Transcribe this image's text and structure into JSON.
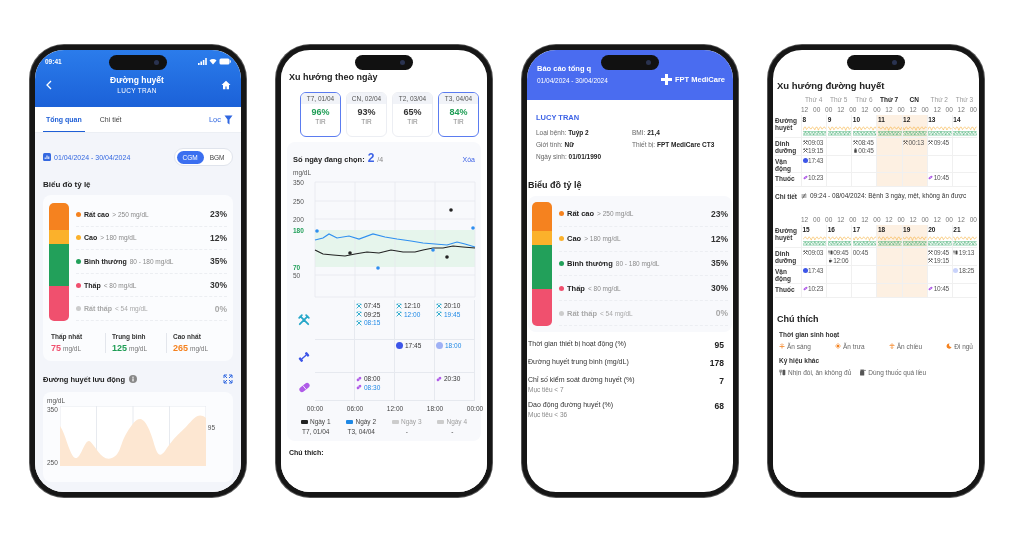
{
  "phones": [
    {
      "kind": "overview",
      "status_time": "09:41",
      "title": "Đường huyết",
      "subtitle": "LUCY TRAN",
      "tabs": [
        {
          "label": "Tổng quan",
          "selected": true
        },
        {
          "label": "Chi tiết",
          "selected": false
        }
      ],
      "filter_label": "Lọc",
      "date_range": "01/04/2024 - 30/04/2024",
      "modes": [
        {
          "label": "CGM",
          "selected": true
        },
        {
          "label": "BGM",
          "selected": false
        }
      ],
      "ratio_title": "Biểu đồ tỷ lệ",
      "ranges": [
        {
          "label": "Rất cao",
          "range": "> 250 mg/dL",
          "percent": "23%",
          "color": "#f5821f",
          "disabled": false
        },
        {
          "label": "Cao",
          "range": "> 180 mg/dL",
          "percent": "12%",
          "color": "#fbb12b",
          "disabled": false
        },
        {
          "label": "Bình thường",
          "range": "80 - 180 mg/dL",
          "percent": "35%",
          "color": "#22a05a",
          "disabled": false
        },
        {
          "label": "Thấp",
          "range": "< 80 mg/dL",
          "percent": "30%",
          "color": "#f0506e",
          "disabled": false
        },
        {
          "label": "Rất thấp",
          "range": "< 54 mg/dL",
          "percent": "0%",
          "color": "#cccccc",
          "disabled": true
        }
      ],
      "stats": [
        {
          "label": "Thấp nhất",
          "value": "75",
          "unit": "mg/dL",
          "color": "#f0506e"
        },
        {
          "label": "Trung bình",
          "value": "125",
          "unit": "mg/dL",
          "color": "#1f9d55"
        },
        {
          "label": "Cao nhất",
          "value": "265",
          "unit": "mg/dL",
          "color": "#f5821f"
        }
      ],
      "ambulatory": {
        "title": "Đường huyết lưu động",
        "unit": "mg/dL",
        "y_labels": [
          "350",
          "250"
        ],
        "right_label": "95"
      }
    },
    {
      "kind": "daily",
      "title": "Xu hướng theo ngày",
      "days": [
        {
          "label": "T7, 01/04",
          "percent": "96%",
          "caption": "TIR",
          "selected": true
        },
        {
          "label": "CN, 02/04",
          "percent": "93%",
          "caption": "TIR",
          "selected": false
        },
        {
          "label": "T2, 03/04",
          "percent": "65%",
          "caption": "TIR",
          "selected": false
        },
        {
          "label": "T3, 04/04",
          "percent": "84%",
          "caption": "TIR",
          "selected": true
        }
      ],
      "selection_label": "Số ngày đang chọn:",
      "selected_count": "2",
      "total_count": "/4",
      "clear_label": "Xóa",
      "chart": {
        "unit": "mg/dL",
        "y_labels": [
          {
            "text": "350",
            "kind": "axis"
          },
          {
            "text": "250",
            "kind": "axis"
          },
          {
            "text": "200",
            "kind": "axis"
          },
          {
            "text": "180",
            "kind": "target"
          },
          {
            "text": "70",
            "kind": "target"
          },
          {
            "text": "50",
            "kind": "axis"
          }
        ],
        "x_labels": [
          "00:00",
          "06:00",
          "12:00",
          "18:00",
          "00:00"
        ]
      },
      "event_rows": [
        {
          "kind": "meal",
          "entries": [
            {
              "time": "07:45",
              "highlighted": false
            },
            {
              "time": "09:25",
              "highlighted": false
            },
            {
              "time": "08:15",
              "highlighted": true
            },
            {
              "time": "12:10",
              "highlighted": false
            },
            {
              "time": "12:00",
              "highlighted": true
            },
            {
              "time": "20:10",
              "highlighted": false
            },
            {
              "time": "19:45",
              "highlighted": true
            }
          ]
        },
        {
          "kind": "exercise",
          "entries": [
            {
              "time": "17:45",
              "highlighted": false,
              "dot": {
                "color": "#3d55e8"
              }
            },
            {
              "time": "18:00",
              "highlighted": true,
              "dot": {
                "color": "#9fb1f5"
              }
            }
          ]
        },
        {
          "kind": "medicine",
          "entries": [
            {
              "time": "08:00",
              "highlighted": false
            },
            {
              "time": "08:30",
              "highlighted": true
            },
            {
              "time": "20:30",
              "highlighted": false
            }
          ]
        }
      ],
      "legend": [
        {
          "label": "Ngày 1",
          "color": "#222222",
          "date": "T7, 01/04",
          "disabled": false
        },
        {
          "label": "Ngày 2",
          "color": "#1e88e5",
          "date": "T3, 04/04",
          "disabled": false
        },
        {
          "label": "Ngày 3",
          "color": "#cccccc",
          "date": "-",
          "disabled": true
        },
        {
          "label": "Ngày 4",
          "color": "#cccccc",
          "date": "-",
          "disabled": true
        }
      ],
      "notes_title": "Chú thích:"
    },
    {
      "kind": "report",
      "title": "Báo cáo tổng q",
      "date_range": "01/04/2024 - 30/04/2024",
      "brand": "FPT MediCare",
      "patient": "LUCY TRAN",
      "info": [
        {
          "label": "Loại bệnh:",
          "value": "Tuýp 2"
        },
        {
          "label": "BMI:",
          "value": "21,4"
        },
        {
          "label": "Giới tính:",
          "value": "Nữ"
        },
        {
          "label": "Thiết bị:",
          "value": "FPT MediCare CT3"
        },
        {
          "label": "Ngày sinh:",
          "value": "01/01/1990"
        }
      ],
      "ratio_title": "Biểu đồ tỷ lệ",
      "ranges": [
        {
          "label": "Rất cao",
          "range": "> 250 mg/dL",
          "percent": "23%",
          "color": "#f5821f",
          "disabled": false
        },
        {
          "label": "Cao",
          "range": "> 180 mg/dL",
          "percent": "12%",
          "color": "#fbb12b",
          "disabled": false
        },
        {
          "label": "Bình thường",
          "range": "80 - 180 mg/dL",
          "percent": "35%",
          "color": "#22a05a",
          "disabled": false
        },
        {
          "label": "Thấp",
          "range": "< 80 mg/dL",
          "percent": "30%",
          "color": "#f0506e",
          "disabled": false
        },
        {
          "label": "Rất thấp",
          "range": "< 54 mg/dL",
          "percent": "0%",
          "color": "#cccccc",
          "disabled": true
        }
      ],
      "metrics": [
        {
          "label": "Thời gian thiết bị hoạt động (%)",
          "value": "95"
        },
        {
          "label": "Đường huyết trung bình (mg/dL)",
          "value": "178"
        },
        {
          "label": "Chỉ số kiểm soát đường huyết (%)",
          "value": "7",
          "target": "Mục tiêu < 7"
        },
        {
          "label": "Dao động đường huyết (%)",
          "value": "68",
          "target": "Mục tiêu < 36"
        }
      ]
    },
    {
      "kind": "weekly",
      "title": "Xu hướng đường huyết",
      "weeks": [
        {
          "rows": [
            {
              "label": "Đường huyết",
              "kind": "glucose"
            },
            {
              "label": "Dinh dưỡng",
              "kind": "nutrition"
            },
            {
              "label": "Vận động",
              "kind": "exercise"
            },
            {
              "label": "Thuốc",
              "kind": "medicine"
            }
          ],
          "hours": [
            "12",
            "00",
            "00",
            "12",
            "00",
            "12",
            "00",
            "12",
            "00",
            "12",
            "00",
            "12",
            "00",
            "12",
            "00"
          ],
          "days": [
            {
              "label": "Thứ 4",
              "weekend": false,
              "date": "8",
              "nutrition": [
                {
                  "time": "09:03",
                  "kind": "meal"
                },
                {
                  "time": "19:15",
                  "kind": "meal"
                }
              ],
              "exercise": [
                {
                  "time": "17:43",
                  "color": "#3d55e8"
                }
              ],
              "medicine": [
                {
                  "time": "10:23"
                }
              ]
            },
            {
              "label": "Thứ 5",
              "weekend": false,
              "date": "9"
            },
            {
              "label": "Thứ 6",
              "weekend": false,
              "date": "10",
              "nutrition": [
                {
                  "time": "08:45",
                  "kind": "meal"
                },
                {
                  "time": "00:45",
                  "kind": "drink"
                }
              ]
            },
            {
              "label": "Thứ 7",
              "weekend": true,
              "date": "11"
            },
            {
              "label": "CN",
              "weekend": true,
              "date": "12",
              "nutrition": [
                {
                  "time": "00:13",
                  "kind": "meal"
                }
              ]
            },
            {
              "label": "Thứ 2",
              "weekend": false,
              "date": "13",
              "nutrition": [
                {
                  "time": "09:45",
                  "kind": "meal"
                }
              ],
              "medicine": [
                {
                  "time": "10:45"
                }
              ]
            },
            {
              "label": "Thứ 3",
              "weekend": false,
              "date": "14"
            }
          ],
          "detail": {
            "label": "Chi tiết",
            "text": "09:24 - 08/04/2024: Bệnh 3 ngày, mệt, không ăn được"
          }
        },
        {
          "rows": [
            {
              "label": "Đường huyết",
              "kind": "glucose"
            },
            {
              "label": "Dinh dưỡng",
              "kind": "nutrition"
            },
            {
              "label": "Vận động",
              "kind": "exercise"
            },
            {
              "label": "Thuốc",
              "kind": "medicine"
            }
          ],
          "hours": [
            "12",
            "00",
            "00",
            "12",
            "00",
            "12",
            "00",
            "12",
            "00",
            "12",
            "00",
            "12",
            "00",
            "12",
            "00"
          ],
          "days": [
            {
              "weekend": false,
              "date": "15",
              "nutrition": [
                {
                  "time": "09:03",
                  "kind": "meal"
                }
              ],
              "exercise": [
                {
                  "time": "17:43",
                  "color": "#3d55e8"
                }
              ],
              "medicine": [
                {
                  "time": "10:23"
                }
              ]
            },
            {
              "weekend": false,
              "date": "16",
              "nutrition": [
                {
                  "time": "09:45",
                  "kind": "fasting"
                },
                {
                  "time": "12:06",
                  "kind": "snack"
                }
              ]
            },
            {
              "weekend": false,
              "date": "17",
              "nutrition": [
                {
                  "time": "00:45",
                  "kind": "plain"
                }
              ]
            },
            {
              "weekend": true,
              "date": "18"
            },
            {
              "weekend": true,
              "date": "19"
            },
            {
              "weekend": false,
              "date": "20",
              "nutrition": [
                {
                  "time": "09:45",
                  "kind": "meal"
                },
                {
                  "time": "19:15",
                  "kind": "meal"
                }
              ],
              "medicine": [
                {
                  "time": "10:45"
                }
              ]
            },
            {
              "weekend": false,
              "date": "21",
              "nutrition": [
                {
                  "time": "19:13",
                  "kind": "fasting"
                }
              ],
              "exercise": [
                {
                  "time": "18:25",
                  "color": "#c9d3fb"
                }
              ]
            }
          ]
        }
      ],
      "legend": {
        "title": "Chú thích",
        "routine_title": "Thời gian sinh hoạt",
        "routine": [
          {
            "label": "Ăn sáng",
            "kind": "breakfast"
          },
          {
            "label": "Ăn trưa",
            "kind": "lunch"
          },
          {
            "label": "Ăn chiều",
            "kind": "dinner"
          },
          {
            "label": "Đi ngủ",
            "kind": "sleep"
          }
        ],
        "other_title": "Ký hiệu khác",
        "other": [
          {
            "label": "Nhịn đói, ăn không đủ",
            "kind": "fasting"
          },
          {
            "label": "Dùng thuốc quá liều",
            "kind": "overdose"
          }
        ]
      }
    }
  ]
}
